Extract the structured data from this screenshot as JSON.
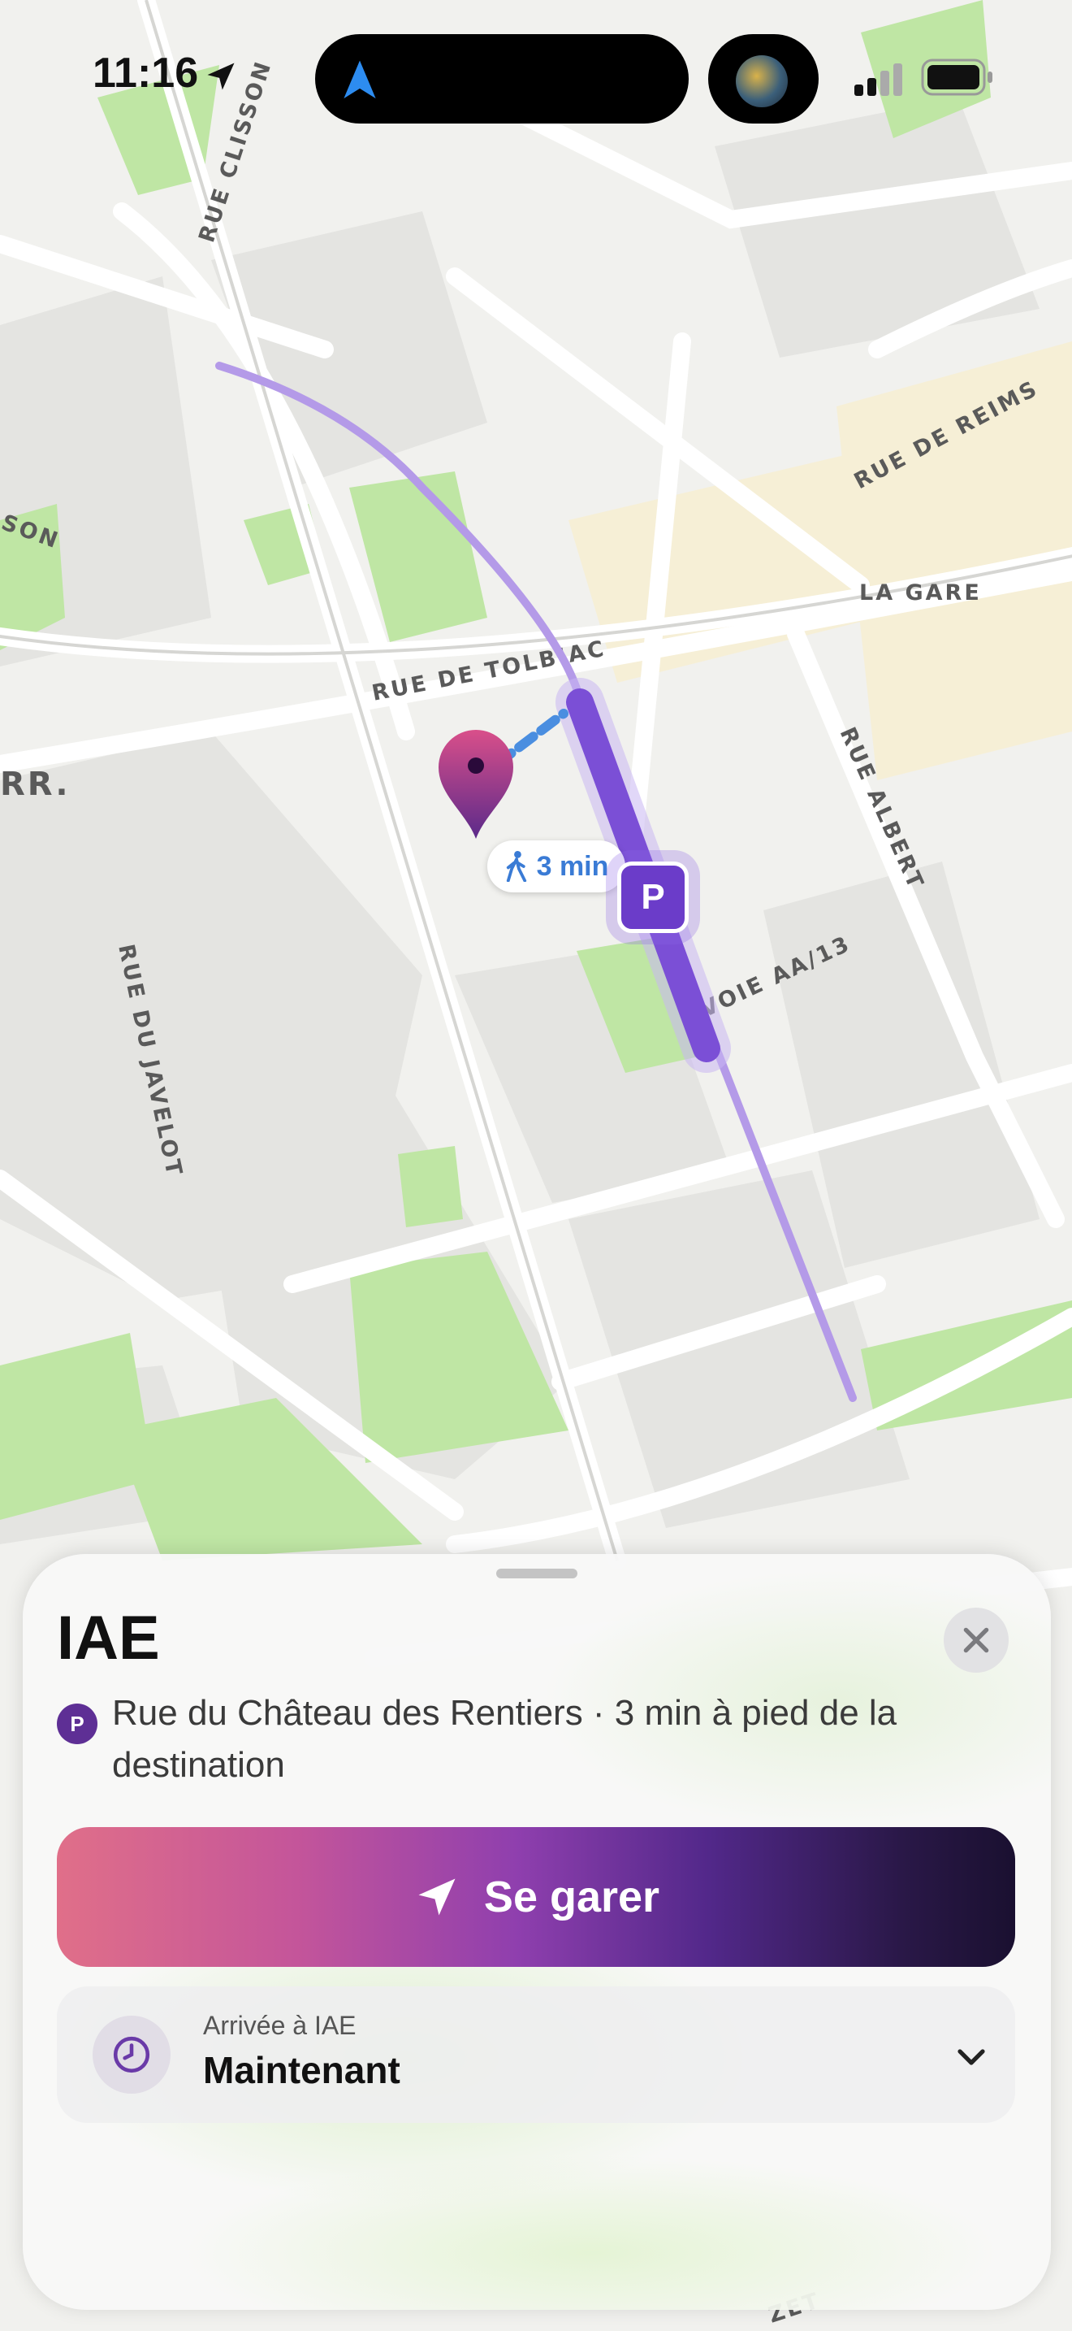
{
  "status_bar": {
    "time": "11:16"
  },
  "map": {
    "streets": [
      "RUE CLISSON",
      "RUE DE REIMS",
      "LA GARE",
      "RUE DE TOLBIAC",
      "RUE ALBERT",
      "VOIE AA/13",
      "RUE DU JAVELOT",
      "SON",
      "RR.",
      "ZET"
    ],
    "walk_time": "3 min",
    "parking_symbol": "P",
    "route_color": "#7b4fd6"
  },
  "sheet": {
    "title": "IAE",
    "parking_badge": "P",
    "subtitle": "Rue du Château des Rentiers · 3 min à pied de la destination",
    "park_button": "Se garer",
    "arrival_label": "Arrivée à IAE",
    "arrival_value": "Maintenant"
  }
}
